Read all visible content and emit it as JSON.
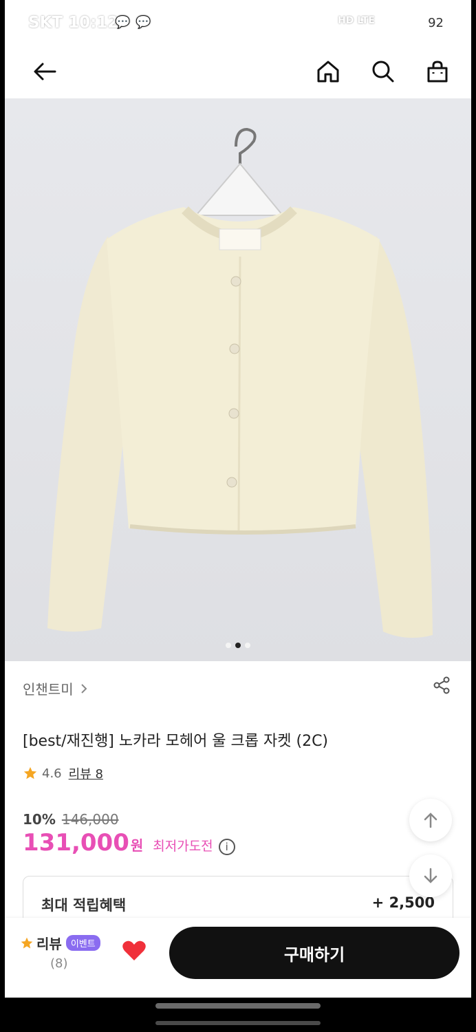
{
  "status_bar": {
    "carrier_time": "SKT 10:12",
    "network": "HD LTE",
    "battery": "92"
  },
  "app_bar": {
    "back_icon": "back-arrow-icon",
    "home_icon": "home-icon",
    "search_icon": "search-icon",
    "cart_icon": "shopping-bag-icon"
  },
  "gallery": {
    "pages": 3,
    "active_page": 2
  },
  "product": {
    "brand": "인챈트미",
    "title": "[best/재진행] 노카라 모헤어 울 크롭 자켓 (2C)",
    "rating": "4.6",
    "review_link": "리뷰 8",
    "discount_rate": "10%",
    "original_price": "146,000",
    "price": "131,000",
    "currency": "원",
    "lowest_price_challenge": "최저가도전",
    "info_icon": "i"
  },
  "benefit": {
    "label": "최대 적립혜택",
    "value": "+ 2,500"
  },
  "bottom_bar": {
    "review_label": "리뷰",
    "event_badge": "이벤트",
    "review_count": "(8)",
    "buy_label": "구매하기"
  },
  "colors": {
    "accent": "#e84fb5",
    "star": "#f5a623",
    "heart": "#f0303a",
    "badge": "#8a6cf0"
  }
}
